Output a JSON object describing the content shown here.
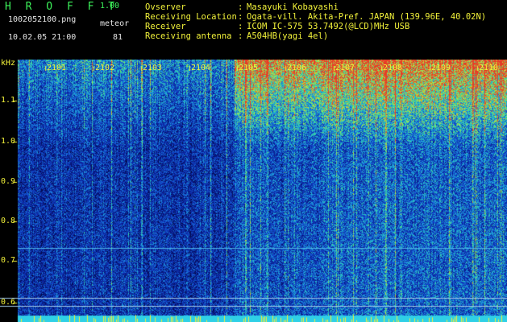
{
  "header": {
    "app_name": "H R O F F T",
    "app_version": "1.00",
    "file_name": "1002052100.png",
    "mode": "meteor",
    "date_time": "10.02.05 21:00",
    "count": "81"
  },
  "info": [
    {
      "label": "Ovserver",
      "value": "Masayuki Kobayashi"
    },
    {
      "label": "Receiving Location",
      "value": "Ogata-vill. Akita-Pref. JAPAN (139.96E, 40.02N)"
    },
    {
      "label": "Receiver",
      "value": "ICOM IC-575 53.7492(@LCD)MHz USB"
    },
    {
      "label": "Receiving antenna",
      "value": "A504HB(yagi 4el)"
    }
  ],
  "colors": {
    "background": "#000000",
    "text_yellow": "#f2f23a",
    "text_cyan": "#34e6e6",
    "text_green": "#3cf25a"
  },
  "spectrogram": {
    "unit_label": "kHz",
    "y_ticks": [
      "1.1",
      "1.0",
      "0.9",
      "0.8",
      "0.7",
      "0.6"
    ],
    "x_ticks": [
      "2101",
      "2102",
      "2103",
      "2104",
      "2105",
      "2106",
      "2107",
      "2108",
      "2109",
      "2110"
    ]
  }
}
